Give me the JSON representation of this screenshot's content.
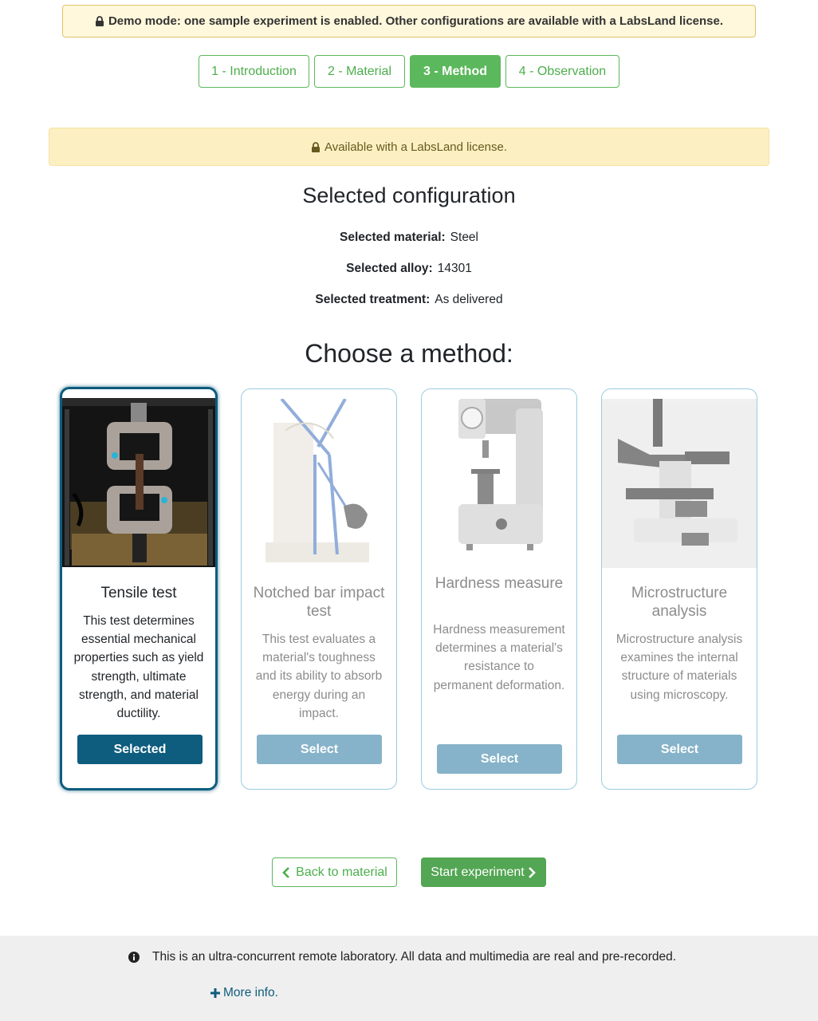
{
  "banner": {
    "icon": "lock-icon",
    "text": "Demo mode: one sample experiment is enabled. Other configurations are available with a LabsLand license."
  },
  "steps": [
    {
      "label": "1 - Introduction",
      "active": false
    },
    {
      "label": "2 - Material",
      "active": false
    },
    {
      "label": "3 - Method",
      "active": true
    },
    {
      "label": "4 - Observation",
      "active": false
    }
  ],
  "license_banner": {
    "icon": "lock-icon",
    "text": "Available with a LabsLand license."
  },
  "config": {
    "heading": "Selected configuration",
    "material_label": "Selected material:",
    "material_value": "Steel",
    "alloy_label": "Selected alloy:",
    "alloy_value": "14301",
    "treatment_label": "Selected treatment:",
    "treatment_value": "As delivered"
  },
  "methods_heading": "Choose a method:",
  "methods": [
    {
      "title": "Tensile test",
      "description": "This test determines essential mechanical properties such as yield strength, ultimate strength, and material ductility.",
      "button": "Selected",
      "selected": true,
      "image": "tensile-machine-photo"
    },
    {
      "title": "Notched bar impact test",
      "description": "This test evaluates a material's toughness and its ability to absorb energy during an impact.",
      "button": "Select",
      "selected": false,
      "image": "pendulum-impact-tester"
    },
    {
      "title": "Hardness measure",
      "description": "Hardness measurement determines a material's resistance to permanent deformation.",
      "button": "Select",
      "selected": false,
      "image": "hardness-tester"
    },
    {
      "title": "Microstructure analysis",
      "description": "Microstructure analysis examines the internal structure of materials using microscopy.",
      "button": "Select",
      "selected": false,
      "image": "microscope"
    }
  ],
  "actions": {
    "back": "Back to material",
    "start": "Start experiment"
  },
  "footer": {
    "info_text": "This is an ultra-concurrent remote laboratory. All data and multimedia are real and pre-recorded.",
    "more_info": "More info."
  },
  "colors": {
    "green": "#5cb85c",
    "blue": "#0e5c7e",
    "light_blue": "#86b3c9",
    "banner_yellow": "#fcf0c2"
  }
}
